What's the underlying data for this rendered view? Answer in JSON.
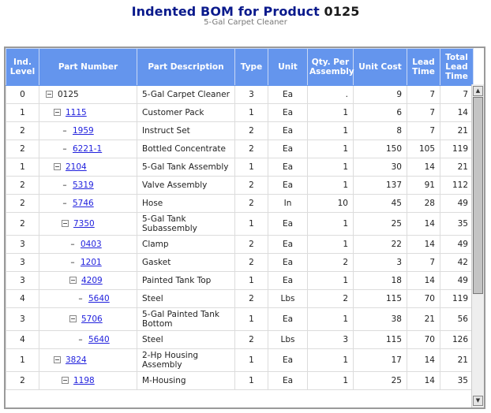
{
  "header": {
    "title_prefix": "Indented BOM for Product",
    "product_number": "0125",
    "subtitle": "5-Gal Carpet Cleaner"
  },
  "columns": [
    "Ind. Level",
    "Part Number",
    "Part Description",
    "Type",
    "Unit",
    "Qty. Per Assembly",
    "Unit Cost",
    "Lead Time",
    "Total Lead Time"
  ],
  "rows": [
    {
      "level": "0",
      "part": "0125",
      "link": false,
      "node": "expand",
      "desc": "5-Gal Carpet Cleaner",
      "type": "3",
      "unit": "Ea",
      "qty": ".",
      "cost": "9",
      "lead": "7",
      "total": "7"
    },
    {
      "level": "1",
      "part": "1115",
      "link": true,
      "node": "expand",
      "desc": "Customer Pack",
      "type": "1",
      "unit": "Ea",
      "qty": "1",
      "cost": "6",
      "lead": "7",
      "total": "14"
    },
    {
      "level": "2",
      "part": "1959",
      "link": true,
      "node": "leaf",
      "desc": "Instruct Set",
      "type": "2",
      "unit": "Ea",
      "qty": "1",
      "cost": "8",
      "lead": "7",
      "total": "21"
    },
    {
      "level": "2",
      "part": "6221-1",
      "link": true,
      "node": "leaf",
      "desc": "Bottled Concentrate",
      "type": "2",
      "unit": "Ea",
      "qty": "1",
      "cost": "150",
      "lead": "105",
      "total": "119"
    },
    {
      "level": "1",
      "part": "2104",
      "link": true,
      "node": "expand",
      "desc": "5-Gal Tank Assembly",
      "type": "1",
      "unit": "Ea",
      "qty": "1",
      "cost": "30",
      "lead": "14",
      "total": "21"
    },
    {
      "level": "2",
      "part": "5319",
      "link": true,
      "node": "leaf",
      "desc": "Valve Assembly",
      "type": "2",
      "unit": "Ea",
      "qty": "1",
      "cost": "137",
      "lead": "91",
      "total": "112"
    },
    {
      "level": "2",
      "part": "5746",
      "link": true,
      "node": "leaf",
      "desc": "Hose",
      "type": "2",
      "unit": "In",
      "qty": "10",
      "cost": "45",
      "lead": "28",
      "total": "49"
    },
    {
      "level": "2",
      "part": "7350",
      "link": true,
      "node": "expand",
      "desc": "5-Gal Tank Subassembly",
      "type": "1",
      "unit": "Ea",
      "qty": "1",
      "cost": "25",
      "lead": "14",
      "total": "35",
      "tall": true
    },
    {
      "level": "3",
      "part": "0403",
      "link": true,
      "node": "leaf",
      "desc": "Clamp",
      "type": "2",
      "unit": "Ea",
      "qty": "1",
      "cost": "22",
      "lead": "14",
      "total": "49"
    },
    {
      "level": "3",
      "part": "1201",
      "link": true,
      "node": "leaf",
      "desc": "Gasket",
      "type": "2",
      "unit": "Ea",
      "qty": "2",
      "cost": "3",
      "lead": "7",
      "total": "42"
    },
    {
      "level": "3",
      "part": "4209",
      "link": true,
      "node": "expand",
      "desc": "Painted Tank Top",
      "type": "1",
      "unit": "Ea",
      "qty": "1",
      "cost": "18",
      "lead": "14",
      "total": "49"
    },
    {
      "level": "4",
      "part": "5640",
      "link": true,
      "node": "leaf",
      "desc": "Steel",
      "type": "2",
      "unit": "Lbs",
      "qty": "2",
      "cost": "115",
      "lead": "70",
      "total": "119"
    },
    {
      "level": "3",
      "part": "5706",
      "link": true,
      "node": "expand",
      "desc": "5-Gal Painted Tank Bottom",
      "type": "1",
      "unit": "Ea",
      "qty": "1",
      "cost": "38",
      "lead": "21",
      "total": "56",
      "tall": true
    },
    {
      "level": "4",
      "part": "5640",
      "link": true,
      "node": "leaf",
      "desc": "Steel",
      "type": "2",
      "unit": "Lbs",
      "qty": "3",
      "cost": "115",
      "lead": "70",
      "total": "126"
    },
    {
      "level": "1",
      "part": "3824",
      "link": true,
      "node": "expand",
      "desc": "2-Hp Housing Assembly",
      "type": "1",
      "unit": "Ea",
      "qty": "1",
      "cost": "17",
      "lead": "14",
      "total": "21",
      "tall": true
    },
    {
      "level": "2",
      "part": "1198",
      "link": true,
      "node": "expand",
      "desc": "M-Housing",
      "type": "1",
      "unit": "Ea",
      "qty": "1",
      "cost": "25",
      "lead": "14",
      "total": "35"
    }
  ],
  "icons": {
    "expand": "collapse-toggle-icon",
    "leaf": "leaf-dash-icon",
    "scroll_up": "▲",
    "scroll_down": "▼"
  },
  "colors": {
    "header_bg": "#6495ed",
    "title": "#0a1a8c",
    "link": "#2222dd"
  }
}
